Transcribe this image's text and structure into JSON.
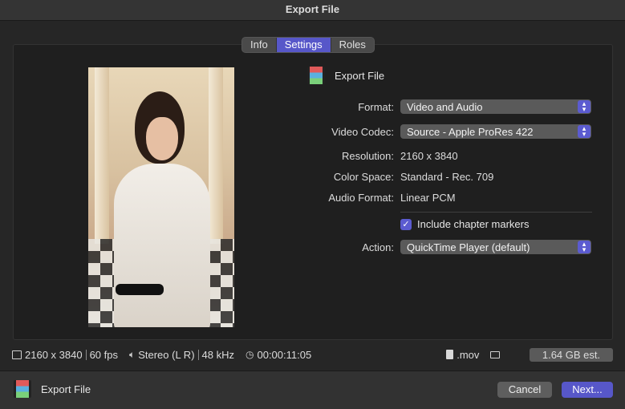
{
  "window": {
    "title": "Export File"
  },
  "tabs": [
    {
      "label": "Info",
      "active": false
    },
    {
      "label": "Settings",
      "active": true
    },
    {
      "label": "Roles",
      "active": false
    }
  ],
  "header": {
    "title": "Export File",
    "icon": "film-icon"
  },
  "settings": {
    "format": {
      "label": "Format:",
      "value": "Video and Audio"
    },
    "video_codec": {
      "label": "Video Codec:",
      "value": "Source - Apple ProRes 422"
    },
    "resolution": {
      "label": "Resolution:",
      "value": "2160 x 3840"
    },
    "color_space": {
      "label": "Color Space:",
      "value": "Standard - Rec. 709"
    },
    "audio_format": {
      "label": "Audio Format:",
      "value": "Linear PCM"
    },
    "chapter_markers": {
      "label": "Include chapter markers",
      "checked": true
    },
    "action": {
      "label": "Action:",
      "value": "QuickTime Player (default)"
    }
  },
  "status": {
    "resolution": "2160 x 3840",
    "fps": "60 fps",
    "audio": "Stereo (L R)",
    "sample_rate": "48 kHz",
    "duration": "00:00:11:05",
    "extension": ".mov",
    "estimate": "1.64 GB est."
  },
  "footer": {
    "title": "Export File",
    "cancel_label": "Cancel",
    "next_label": "Next..."
  },
  "colors": {
    "accent": "#5757c9",
    "background": "#262626"
  }
}
